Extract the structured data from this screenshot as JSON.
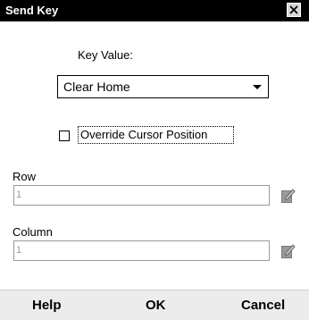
{
  "window": {
    "title": "Send Key"
  },
  "key_value": {
    "label": "Key Value:",
    "selected": "Clear Home"
  },
  "override": {
    "label": "Override Cursor Position",
    "checked": false
  },
  "row": {
    "label": "Row",
    "value": "1"
  },
  "column": {
    "label": "Column",
    "value": "1"
  },
  "buttons": {
    "help": "Help",
    "ok": "OK",
    "cancel": "Cancel"
  },
  "icons": {
    "close": "close-icon",
    "dropdown": "chevron-down-icon",
    "row_edit": "pencil-edit-icon",
    "column_edit": "pencil-edit-icon"
  }
}
